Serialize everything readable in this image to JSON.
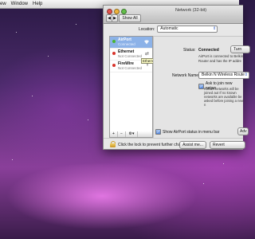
{
  "menubar": {
    "items": [
      "ew",
      "Window",
      "Help"
    ]
  },
  "window": {
    "title": "Network (32-bit)",
    "show_all": "Show All",
    "back_glyph": "◀",
    "forward_glyph": "▶",
    "location_label": "Location:",
    "location_value": "Automatic"
  },
  "services": [
    {
      "name": "AirPort",
      "status": "Connected",
      "dot": "green",
      "icon": "wifi-icon"
    },
    {
      "name": "Ethernet",
      "status": "Not Connected",
      "dot": "red",
      "icon": "ethernet-icon"
    },
    {
      "name": "FireWire",
      "status": "Not Connected",
      "dot": "red",
      "icon": "firewire-icon"
    }
  ],
  "tooltip": "Ethernet",
  "sidebar_tools": [
    "+",
    "−",
    "⚙▾"
  ],
  "detail": {
    "status_label": "Status:",
    "status_value": "Connected",
    "turn_button": "Turn",
    "status_desc": "AirPort is connected to Belkin Router and has the IP addre",
    "network_name_label": "Network Name:",
    "network_name_value": "Belkin N Wireless Route",
    "ask_label": "Ask to join new netwo",
    "ask_desc": "Known networks will be joined aut If no known networks are available be asked before joining a new n",
    "show_airport_label": "Show AirPort status in menu bar",
    "advanced_button": "Adv"
  },
  "bottom": {
    "lock_text": "Click the lock to prevent further changes.",
    "assist_button": "Assist me...",
    "revert_button": "Revert"
  },
  "colors": {
    "accent": "#4f82d8",
    "selection": "#8cb2e8"
  }
}
